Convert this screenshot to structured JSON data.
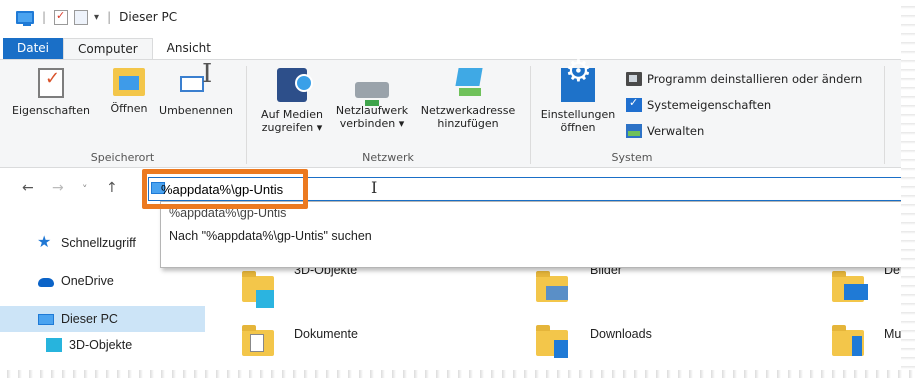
{
  "window": {
    "title": "Dieser PC",
    "qa_dropdown": "▾",
    "separator": "|"
  },
  "tabs": [
    {
      "label": "Datei"
    },
    {
      "label": "Computer"
    },
    {
      "label": "Ansicht"
    }
  ],
  "ribbon": {
    "groups": {
      "speicherort": {
        "label": "Speicherort",
        "buttons": {
          "properties": "Eigenschaften",
          "open": "Öffnen",
          "rename": "Umbenennen"
        }
      },
      "netzwerk": {
        "label": "Netzwerk",
        "buttons": {
          "media_l1": "Auf Medien",
          "media_l2": "zugreifen ▾",
          "drive_l1": "Netzlaufwerk",
          "drive_l2": "verbinden ▾",
          "netaddr_l1": "Netzwerkadresse",
          "netaddr_l2": "hinzufügen"
        }
      },
      "system": {
        "label": "System",
        "buttons": {
          "settings_l1": "Einstellungen",
          "settings_l2": "öffnen",
          "uninstall": "Programm deinstallieren oder ändern",
          "sysprops": "Systemeigenschaften",
          "manage": "Verwalten"
        }
      }
    }
  },
  "nav": {
    "back": "←",
    "forward": "→",
    "recent": "˅",
    "up": "↑"
  },
  "address": {
    "value": "%appdata%\\gp-Untis"
  },
  "autocomplete": [
    {
      "label": "%appdata%\\gp-Untis"
    },
    {
      "label": "Nach \"%appdata%\\gp-Untis\" suchen"
    }
  ],
  "sidebar": {
    "items": [
      {
        "label": "Schnellzugriff"
      },
      {
        "label": "OneDrive"
      },
      {
        "label": "Dieser PC"
      },
      {
        "label": "3D-Objekte"
      }
    ]
  },
  "folders": [
    {
      "label": "3D-Objekte"
    },
    {
      "label": "Bilder"
    },
    {
      "label": "De"
    },
    {
      "label": "Dokumente"
    },
    {
      "label": "Downloads"
    },
    {
      "label": "Mu"
    }
  ],
  "colors": {
    "accent": "#1a6fc7",
    "highlight": "#ec7a20",
    "selection": "#cce4f7",
    "folder": "#f3c64a"
  }
}
